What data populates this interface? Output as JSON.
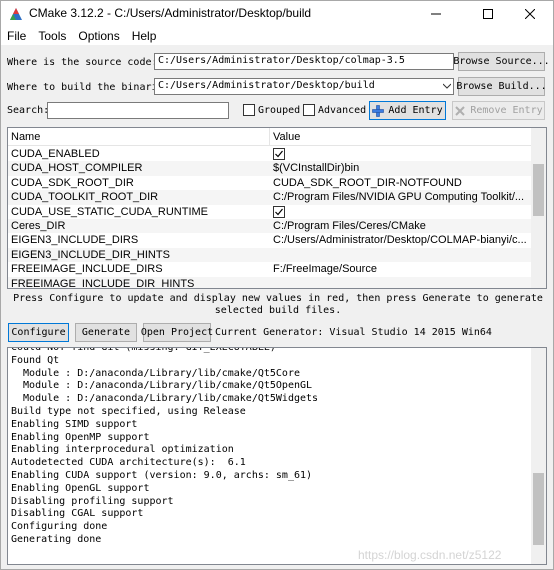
{
  "window": {
    "title": "CMake 3.12.2 - C:/Users/Administrator/Desktop/build"
  },
  "menu": [
    "File",
    "Tools",
    "Options",
    "Help"
  ],
  "source": {
    "label": "Where is the source code:",
    "value": "C:/Users/Administrator/Desktop/colmap-3.5",
    "browse_label": "Browse Source..."
  },
  "build": {
    "label": "Where to build the binaries:",
    "value": "C:/Users/Administrator/Desktop/build",
    "browse_label": "Browse Build..."
  },
  "search": {
    "label": "Search:",
    "value": "",
    "grouped_label": "Grouped",
    "grouped_checked": false,
    "advanced_label": "Advanced",
    "advanced_checked": false,
    "add_entry_label": "Add Entry",
    "remove_entry_label": "Remove Entry"
  },
  "table": {
    "columns": [
      "Name",
      "Value"
    ],
    "rows": [
      {
        "name": "CUDA_ENABLED",
        "value": "",
        "checkbox": true,
        "checked": true
      },
      {
        "name": "CUDA_HOST_COMPILER",
        "value": "$(VCInstallDir)bin"
      },
      {
        "name": "CUDA_SDK_ROOT_DIR",
        "value": "CUDA_SDK_ROOT_DIR-NOTFOUND"
      },
      {
        "name": "CUDA_TOOLKIT_ROOT_DIR",
        "value": "C:/Program Files/NVIDIA GPU Computing Toolkit/..."
      },
      {
        "name": "CUDA_USE_STATIC_CUDA_RUNTIME",
        "value": "",
        "checkbox": true,
        "checked": true
      },
      {
        "name": "Ceres_DIR",
        "value": "C:/Program Files/Ceres/CMake"
      },
      {
        "name": "EIGEN3_INCLUDE_DIRS",
        "value": "C:/Users/Administrator/Desktop/COLMAP-bianyi/c..."
      },
      {
        "name": "EIGEN3_INCLUDE_DIR_HINTS",
        "value": ""
      },
      {
        "name": "FREEIMAGE_INCLUDE_DIRS",
        "value": "F:/FreeImage/Source"
      },
      {
        "name": "FREEIMAGE_INCLUDE_DIR_HINTS",
        "value": ""
      }
    ]
  },
  "message": "Press Configure to update and display new values in red, then press Generate to generate selected build files.",
  "actions": {
    "configure_label": "Configure",
    "generate_label": "Generate",
    "open_project_label": "Open Project",
    "current_generator": "Current Generator: Visual Studio 14 2015 Win64"
  },
  "log": [
    "Could NOT find Git (missing: GIT_EXECUTABLE)",
    "Found Qt",
    "  Module : D:/anaconda/Library/lib/cmake/Qt5Core",
    "  Module : D:/anaconda/Library/lib/cmake/Qt5OpenGL",
    "  Module : D:/anaconda/Library/lib/cmake/Qt5Widgets",
    "Build type not specified, using Release",
    "Enabling SIMD support",
    "Enabling OpenMP support",
    "Enabling interprocedural optimization",
    "Autodetected CUDA architecture(s):  6.1",
    "Enabling CUDA support (version: 9.0, archs: sm_61)",
    "Enabling OpenGL support",
    "Disabling profiling support",
    "Disabling CGAL support",
    "Configuring done",
    "Generating done"
  ],
  "watermark": "https://blog.csdn.net/z5122"
}
